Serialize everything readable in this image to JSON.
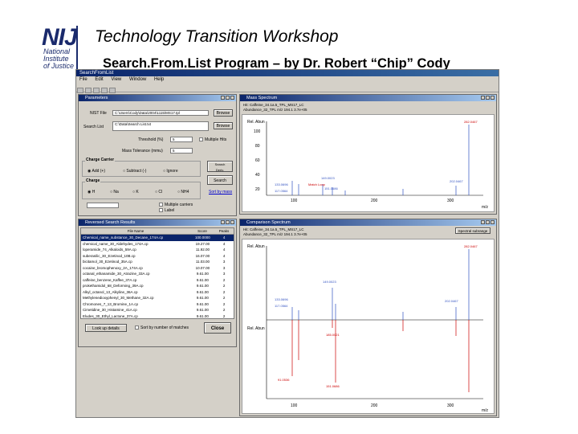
{
  "slide": {
    "title": "Technology Transition Workshop",
    "subtitle": "Search.From.List Program – by Dr. Robert “Chip” Cody",
    "logo": {
      "mark": "NIJ",
      "lines": [
        "National",
        "Institute",
        "of Justice"
      ]
    }
  },
  "app": {
    "title": "SearchFromList",
    "menu": [
      "File",
      "Edit",
      "View",
      "Window",
      "Help"
    ]
  },
  "params": {
    "title": "Parameters",
    "nist_file_label": "NIST File",
    "nist_file_value": "C:\\Users\\Cody\\Data\\2004\\1115\\MS17.tpl",
    "search_list_label": "Search List",
    "search_list_value": "C:\\Data\\Search List.txt",
    "threshold_label": "Threshold (%)",
    "threshold_value": "5",
    "multiple_hits_label": "Multiple Hits",
    "mass_tol_label": "Mass Tolerance (mmu)",
    "mass_tol_value": "5",
    "browse_label": "Browse",
    "search_btn": "Search",
    "charge_carrier_title": "Charge Carrier",
    "carrier_options": [
      "Add (+)",
      "Subtract (-)",
      "Ignore"
    ],
    "charge_title": "Charge",
    "charge_options": [
      "H",
      "Na",
      "K",
      "Cl",
      "NH4"
    ],
    "multiple_carrier_label": "Multiple carriers",
    "label_label": "Label",
    "sort_by_mass": "Sort by mass"
  },
  "results": {
    "title": "Reversed Search Results",
    "columns": [
      "File Name",
      "Score",
      "Peaks"
    ],
    "rows": [
      [
        "Chemical_name_substance_30_Decane_174A.cp",
        "100.0000",
        "4"
      ],
      [
        "chemical_name_30_Aldehydes_174A.cp",
        "19.27.00",
        "4"
      ],
      [
        "loperamide_74_Alkaloids_59A.cp",
        "11.92.00",
        "4"
      ],
      [
        "suberanilic_30_Ezetinod_10B.cp",
        "16.07.00",
        "4"
      ],
      [
        "bicitamol_30_Ezetinod_35A.cp",
        "11.03.00",
        "3"
      ],
      [
        "cocaine_bromophenoxy_2A_174A.cp",
        "10.07.00",
        "3"
      ],
      [
        "octanal_ethanamide_30_Atrazine_33A.cp",
        "9.61.00",
        "3"
      ],
      [
        "caffeine_benzene_Kaffee_37A.cp",
        "9.61.00",
        "2"
      ],
      [
        "prokethamidol_68_Deforming_39A.cp",
        "9.61.00",
        "2"
      ],
      [
        "Alkyl_octanol_13_Alkyline_36A.cp",
        "9.61.00",
        "2"
      ],
      [
        "Methylenedioxyphenyl_30_Methane_32A.cp",
        "9.61.00",
        "2"
      ],
      [
        "Chromones_7_13_Bromine_1A.cp",
        "9.61.00",
        "2"
      ],
      [
        "Cimetidine_30_Histamine_41A.cp",
        "9.61.00",
        "2"
      ],
      [
        "Eludes_30_Ethyl_Lactone_37A.cp",
        "9.61.00",
        "2"
      ]
    ],
    "lookup_btn": "Look up details",
    "sort_label": "Sort by number of matches",
    "close_btn": "Close"
  },
  "mass_spectrum": {
    "title": "Mass Spectrum",
    "header1": "Hit: Caffeine_34.1a.5_TPL_MS17_LC",
    "header2": "Abundance_32_TPL  m/z 194.1  3.7e+05",
    "yaxis_label": "Rel. Abun",
    "yticks": [
      "100",
      "80",
      "60",
      "40",
      "20"
    ],
    "xticks": [
      "100",
      "200",
      "300"
    ],
    "x_unit": "m/z",
    "peak_labels": [
      "133.0696",
      "117.0564",
      "91.0536",
      "95.0559",
      "113.0609",
      "149.0023",
      "151.0686",
      "202.0467",
      "282.0467"
    ],
    "annotation_label": "Match Loop"
  },
  "comparison": {
    "title": "Comparison Spectrum",
    "header1": "Hit: Caffeine_34.1a.5_TPL_MS17_LC",
    "header2": "Abundance_32_TPL  m/z 194.1  3.7e+05",
    "spectral_label": "Spectral subrange",
    "yaxis_label": "Rel. Abun",
    "xticks": [
      "100",
      "200",
      "300"
    ],
    "x_unit": "m/z",
    "peak_labels": [
      "133.0696",
      "117.0564",
      "91.0536",
      "95.0559",
      "149.0023",
      "151.0686",
      "282.0467",
      "202.0467",
      "185.0021"
    ]
  }
}
